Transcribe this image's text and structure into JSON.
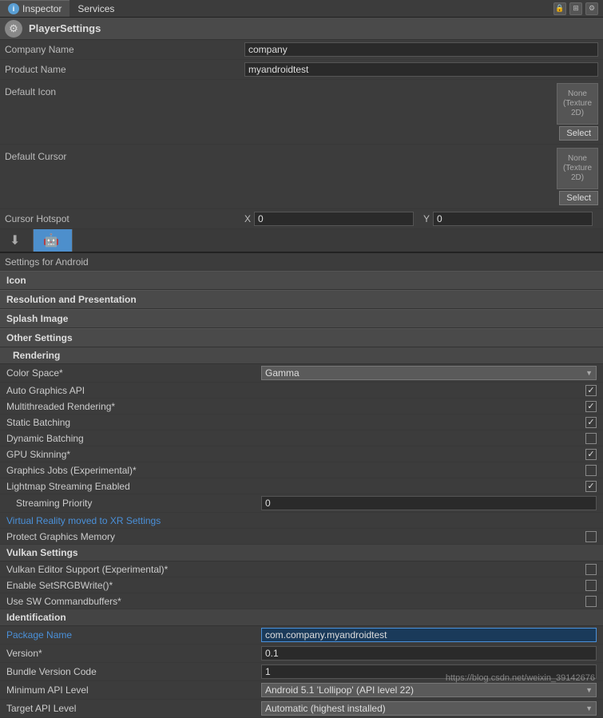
{
  "tabs": [
    {
      "label": "Inspector",
      "active": true,
      "icon": "i"
    },
    {
      "label": "Services",
      "active": false
    }
  ],
  "window_controls": [
    "lock",
    "split-view",
    "more"
  ],
  "header": {
    "title": "PlayerSettings",
    "icon": "⚙"
  },
  "fields": {
    "company_name_label": "Company Name",
    "company_name_value": "company",
    "product_name_label": "Product Name",
    "product_name_value": "myandroidtest",
    "default_icon_label": "Default Icon",
    "default_icon_texture": "None (Texture 2D)",
    "select_label": "Select",
    "default_cursor_label": "Default Cursor",
    "default_cursor_texture": "None (Texture 2D)",
    "cursor_hotspot_label": "Cursor Hotspot",
    "x_label": "X",
    "x_value": "0",
    "y_label": "Y",
    "y_value": "0"
  },
  "platforms": [
    {
      "icon": "⬇",
      "label": "",
      "active": false
    },
    {
      "icon": "🤖",
      "label": "",
      "active": true
    }
  ],
  "settings_for": "Settings for Android",
  "sections": [
    {
      "label": "Icon"
    },
    {
      "label": "Resolution and Presentation"
    },
    {
      "label": "Splash Image"
    },
    {
      "label": "Other Settings"
    }
  ],
  "rendering": {
    "header": "Rendering",
    "color_space_label": "Color Space*",
    "color_space_value": "Gamma",
    "auto_graphics_label": "Auto Graphics API",
    "auto_graphics_checked": true,
    "multithreaded_label": "Multithreaded Rendering*",
    "multithreaded_checked": true,
    "static_batching_label": "Static Batching",
    "static_batching_checked": true,
    "dynamic_batching_label": "Dynamic Batching",
    "dynamic_batching_checked": false,
    "gpu_skinning_label": "GPU Skinning*",
    "gpu_skinning_checked": true,
    "graphics_jobs_label": "Graphics Jobs (Experimental)*",
    "graphics_jobs_checked": false,
    "lightmap_streaming_label": "Lightmap Streaming Enabled",
    "lightmap_streaming_checked": true,
    "streaming_priority_label": "Streaming Priority",
    "streaming_priority_value": "0",
    "vr_link_text": "Virtual Reality moved to XR Settings",
    "protect_graphics_label": "Protect Graphics Memory",
    "protect_graphics_checked": false
  },
  "vulkan": {
    "header": "Vulkan Settings",
    "editor_support_label": "Vulkan Editor Support (Experimental)*",
    "editor_support_checked": false,
    "srgb_write_label": "Enable SetSRGBWrite()*",
    "srgb_write_checked": false,
    "sw_commandbuffers_label": "Use SW Commandbuffers*",
    "sw_commandbuffers_checked": false
  },
  "identification": {
    "header": "Identification",
    "package_name_label": "Package Name",
    "package_name_value": "com.company.myandroidtest",
    "version_label": "Version*",
    "version_value": "0.1",
    "bundle_version_label": "Bundle Version Code",
    "bundle_version_value": "1",
    "min_api_label": "Minimum API Level",
    "min_api_value": "Android 5.1 'Lollipop' (API level 22)",
    "target_api_label": "Target API Level",
    "target_api_value": "Automatic (highest installed)"
  },
  "watermark": "https://blog.csdn.net/weixin_39142676"
}
